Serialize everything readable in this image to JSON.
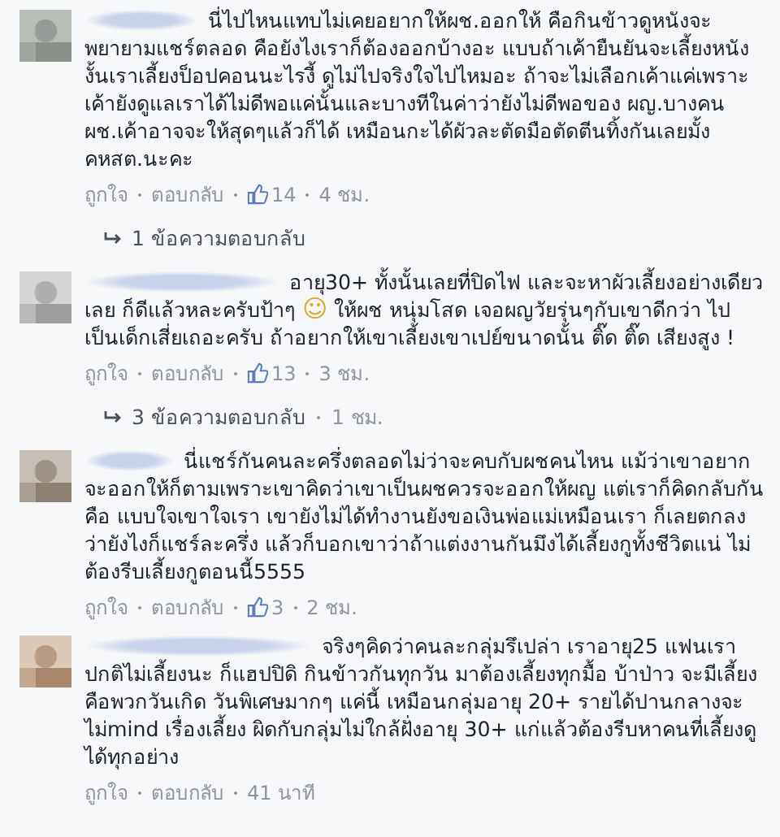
{
  "comments": [
    {
      "body": [
        {
          "kind": "text",
          "text": "นี่ไปไหนแทบไม่เคยอยากให้ผช.ออกให้ คือกินข้าวดูหนังจะพยายามแชร์ตลอด คือยังไงเราก็ต้องออกบ้างอะ แบบถ้าเค้ายืนยันจะเลี้ยงหนังงั้นเราเลี้ยงป็อปคอนนะไรงี้ ดูไม่ไปจริงใจไปไหมอะ ถ้าจะไม่เลือกเค้าแค่เพราะเค้ายังดูแลเราได้ไม่ดีพอแค่นั้นและบางทีในค่าว่ายังไม่ดีพอของ ผญ.บางคน ผช.เค้าอาจจะให้สุดๆแล้วก็ได้ เหมือนกะได้ผัวละตัดมือตัดตีนทิ้งกันเลยมั้ง คหสต.นะคะ"
        }
      ],
      "like": "ถูกใจ",
      "reply": "ตอบกลับ",
      "likes": "14",
      "time": "4 ชม.",
      "replies": {
        "count": "1 ข้อความตอบกลับ"
      }
    },
    {
      "body": [
        {
          "kind": "text",
          "text": "อายุ30+ ทั้งนั้นเลยที่ปิดไฟ และจะหาผัวเลี้ยงอย่างเดียวเลย ก็ดีแล้วหละครับป้าๆ "
        },
        {
          "kind": "emoji",
          "text": "☺"
        },
        {
          "kind": "text",
          "text": " ให้ผช หนุ่มโสด เจอผญวัยรุ่นๆกับเขาดีกว่า ไปเป็นเด็กเสี่ยเถอะครับ ถ้าอยากให้เขาเลี้ยงเขาเปย์ขนาดนั้น ติ๊ด ติ๊ด เสียงสูง !"
        }
      ],
      "like": "ถูกใจ",
      "reply": "ตอบกลับ",
      "likes": "13",
      "time": "3 ชม.",
      "replies": {
        "count": "3 ข้อความตอบกลับ",
        "time": "1 ชม."
      }
    },
    {
      "body": [
        {
          "kind": "text",
          "text": "นี่แชร์กันคนละครึ่งตลอดไม่ว่าจะคบกับผชคนไหน แม้ว่าเขาอยากจะออกให้ก็ตามเพราะเขาคิดว่าเขาเป็นผชควรจะออกให้ผญ แต่เราก็คิดกลับกันคือ แบบใจเขาใจเรา เขายังไม่ได้ทำงานยังขอเงินพ่อแม่เหมือนเรา ก็เลยตกลงว่ายังไงก็แชร์ละครึ่ง แล้วก็บอกเขาว่าถ้าแต่งงานกันมึงได้เลี้ยงกูทั้งชีวิตแน่ ไม่ต้องรีบเลี้ยงกูตอนนี้5555"
        }
      ],
      "like": "ถูกใจ",
      "reply": "ตอบกลับ",
      "likes": "3",
      "time": "2 ชม."
    },
    {
      "body": [
        {
          "kind": "text",
          "text": "จริงๆคิดว่าคนละกลุ่มรึเปล่า เราอายุ25 แฟนเราปกติไม่เลี้ยงนะ ก็แฮปปิดิ กินข้าวกันทุกวัน มาต้องเลี้ยงทุกมื้อ บ้าป่าว จะมีเลี้ยงคือพวกวันเกิด วันพิเศษมากๆ แค่นี้ เหมือนกลุ่มอายุ 20+ รายได้ปานกลางจะไม่mind เรื่องเลี้ยง ผิดกับกลุ่มไม่ใกล้ฝั่งอายุ 30+ แก่แล้วต้องรีบหาคนที่เลี้ยงดูได้ทุกอย่าง"
        }
      ],
      "like": "ถูกใจ",
      "reply": "ตอบกลับ",
      "time": "41 นาที"
    }
  ]
}
